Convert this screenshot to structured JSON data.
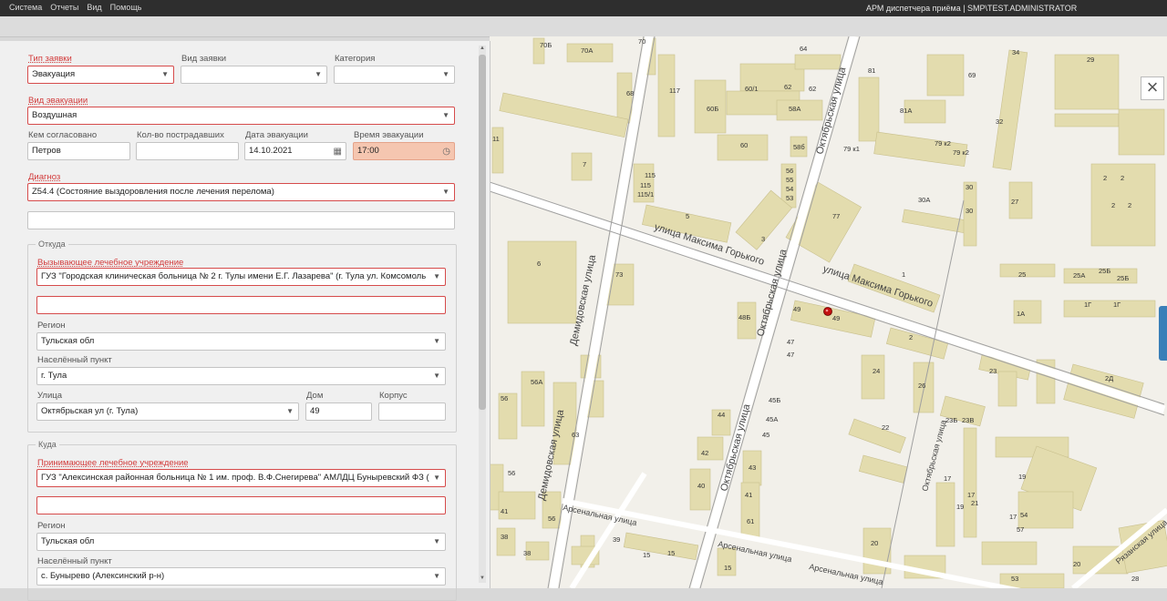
{
  "menubar": {
    "items": [
      "Система",
      "Отчеты",
      "Вид",
      "Помощь"
    ],
    "app_title": "АРМ диспетчера приёма | SMP\\TEST.ADMINISTRATOR"
  },
  "form": {
    "request_type": {
      "label": "Тип заявки",
      "value": "Эвакуация"
    },
    "request_kind": {
      "label": "Вид заявки",
      "value": ""
    },
    "category": {
      "label": "Категория",
      "value": ""
    },
    "evac_type": {
      "label": "Вид эвакуации",
      "value": "Воздушная"
    },
    "approved_by": {
      "label": "Кем согласовано",
      "value": "Петров"
    },
    "victims_count": {
      "label": "Кол-во пострадавших",
      "value": ""
    },
    "evac_date": {
      "label": "Дата эвакуации",
      "value": "14.10.2021"
    },
    "evac_time": {
      "label": "Время эвакуации",
      "value": "17:00"
    },
    "diagnosis": {
      "label": "Диагноз",
      "value": "Z54.4 (Состояние выздоровления после лечения перелома)"
    },
    "diagnosis_extra": {
      "value": ""
    },
    "from": {
      "title": "Откуда",
      "facility_label": "Вызывающее лечебное учреждение",
      "facility_value": "ГУЗ \"Городская клиническая больница № 2 г. Тулы имени Е.Г. Лазарева\" (г. Тула ул. Комсомоль",
      "extra_value": "",
      "region_label": "Регион",
      "region_value": "Тульская обл",
      "locality_label": "Населённый пункт",
      "locality_value": "г. Тула",
      "street_label": "Улица",
      "street_value": "Октябрьская ул (г. Тула)",
      "house_label": "Дом",
      "house_value": "49",
      "building_label": "Корпус",
      "building_value": ""
    },
    "to": {
      "title": "Куда",
      "facility_label": "Принимающее лечебное учреждение",
      "facility_value": "ГУЗ \"Алексинская районная больница № 1 им. проф. В.Ф.Снегирева\" АМЛДЦ Буныревский ФЗ (",
      "extra_value": "",
      "region_label": "Регион",
      "region_value": "Тульская обл",
      "locality_label": "Населённый пункт",
      "locality_value": "с. Бунырево (Алексинский р-н)"
    }
  },
  "map": {
    "close_label": "×",
    "streets": {
      "gorkogo_1": "улица Максима Горького",
      "gorkogo_2": "улица Максима Горького",
      "demidovskaya_1": "Демидовская улица",
      "demidovskaya_2": "Демидовская улица",
      "oktyabrskaya_1": "Октябрьская улица",
      "oktyabrskaya_2": "Октябрьская улица",
      "oktyabrskaya_3": "Октябрьская улица",
      "arsenalnaya_1": "Арсенальная улица",
      "arsenalnaya_2": "Арсенальная улица",
      "arsenalnaya_3": "Арсенальная улица",
      "ryazanskaya": "Рязанская улица",
      "oktyabrskaya_4": "Октябрьская улица"
    },
    "house_numbers": [
      "70Б",
      "70А",
      "70",
      "64",
      "81",
      "34",
      "29",
      "69",
      "68",
      "117",
      "60/1",
      "62",
      "62",
      "60Б",
      "58А",
      "81А",
      "32",
      "60",
      "58б",
      "79 к1",
      "79 к2",
      "79 к2",
      "11",
      "7",
      "115",
      "115",
      "115/1",
      "56",
      "55",
      "54",
      "53",
      "2",
      "2",
      "2",
      "2",
      "30",
      "30",
      "30А",
      "27",
      "5",
      "3",
      "77",
      "6",
      "73",
      "1",
      "25",
      "25А",
      "25Б",
      "25Б",
      "48Б",
      "49",
      "49",
      "1А",
      "1Г",
      "1Г",
      "47",
      "47",
      "2",
      "24",
      "23",
      "26",
      "2Д",
      "56А",
      "56",
      "45Б",
      "45А",
      "45",
      "44",
      "42",
      "22",
      "23Б",
      "23В",
      "63",
      "56",
      "43",
      "40",
      "41",
      "41",
      "56",
      "61",
      "20",
      "19",
      "17",
      "17",
      "17",
      "19",
      "21",
      "54",
      "57",
      "38",
      "38",
      "39",
      "15",
      "15",
      "15",
      "53",
      "20",
      "28"
    ],
    "marker_label": "49"
  }
}
